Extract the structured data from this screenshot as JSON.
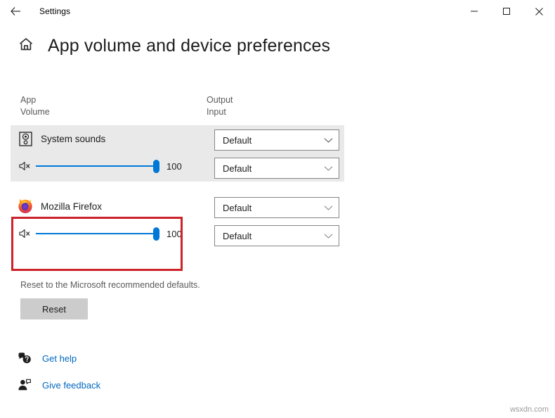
{
  "window": {
    "title": "Settings",
    "back_icon": "back-arrow-icon",
    "minimize_icon": "minimize-icon",
    "maximize_icon": "maximize-icon",
    "close_icon": "close-icon"
  },
  "header": {
    "home_icon": "home-icon",
    "title": "App volume and device preferences"
  },
  "columns": {
    "app": "App",
    "volume": "Volume",
    "output": "Output",
    "input": "Input"
  },
  "rows": [
    {
      "app_name": "System sounds",
      "app_icon": "speaker-box-icon",
      "mute_icon": "speaker-mute-icon",
      "volume": "100",
      "output": "Default",
      "input": "Default",
      "highlighted_background": true,
      "red_outline": false
    },
    {
      "app_name": "Mozilla Firefox",
      "app_icon": "firefox-icon",
      "mute_icon": "speaker-mute-icon",
      "volume": "100",
      "output": "Default",
      "input": "Default",
      "highlighted_background": false,
      "red_outline": true
    }
  ],
  "reset": {
    "description": "Reset to the Microsoft recommended defaults.",
    "button_label": "Reset"
  },
  "footer": {
    "links": [
      {
        "label": "Get help",
        "icon": "help-bubble-icon"
      },
      {
        "label": "Give feedback",
        "icon": "feedback-person-icon"
      }
    ]
  },
  "watermark": "wsxdn.com",
  "colors": {
    "accent": "#0078d7",
    "link": "#0067c0",
    "highlight_outline": "#cc2229",
    "row_hover_bg": "#e9e9e9",
    "button_bg": "#cccccc"
  }
}
